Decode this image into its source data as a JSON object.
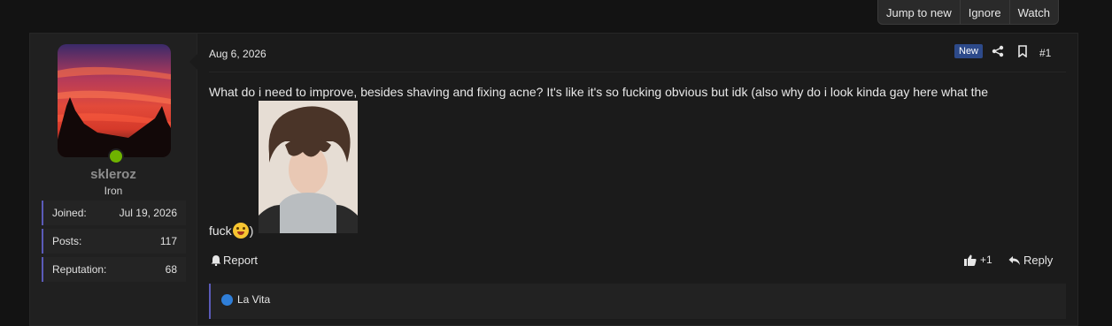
{
  "toolbar": {
    "jump_label": "Jump to new",
    "ignore_label": "Ignore",
    "watch_label": "Watch"
  },
  "user": {
    "name": "skleroz",
    "title": "Iron",
    "stats": [
      {
        "label": "Joined:",
        "value": "Jul 19, 2026"
      },
      {
        "label": "Posts:",
        "value": "117"
      },
      {
        "label": "Reputation:",
        "value": "68"
      }
    ],
    "status_color": "#6fb300"
  },
  "post": {
    "date": "Aug 6, 2026",
    "badge": "New",
    "number": "#1",
    "text": "What do i need to improve, besides shaving and fixing acne? It's like it's so fucking obvious but idk (also why do i look kinda gay here what the",
    "tail_before": "fuck",
    "tail_after": ")"
  },
  "actions": {
    "report_label": "Report",
    "like_count": "+1",
    "reply_label": "Reply"
  },
  "likes": {
    "user": "La Vita"
  },
  "colors": {
    "accent": "#5b5bb8",
    "badge": "#2d4a8a",
    "background": "#131313"
  }
}
